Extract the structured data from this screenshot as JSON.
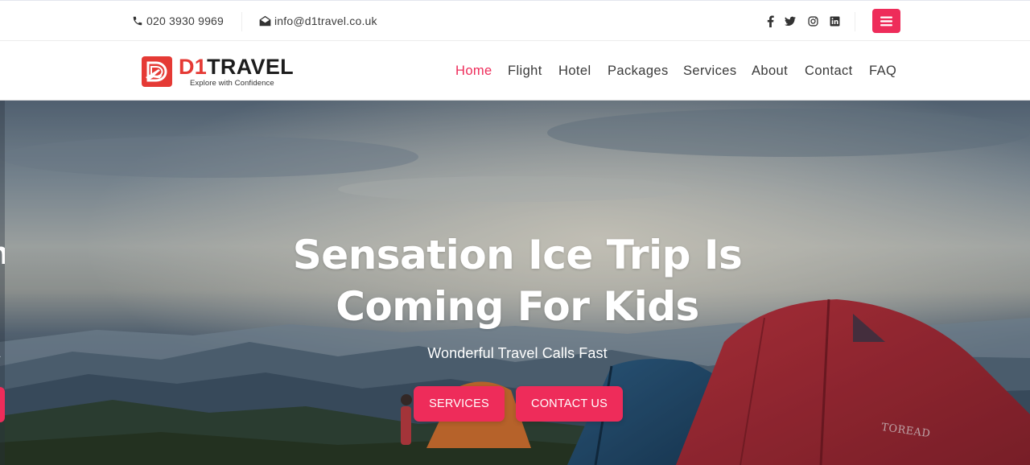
{
  "topbar": {
    "phone": "020 3930 9969",
    "email": "info@d1travel.co.uk",
    "phone_icon": "phone-icon",
    "email_icon": "envelope-icon",
    "social": [
      "facebook-icon",
      "twitter-icon",
      "instagram-icon",
      "linkedin-icon"
    ],
    "menu_icon": "hamburger-menu-icon"
  },
  "brand": {
    "name_prefix": "D1",
    "name_suffix": "TRAVEL",
    "tagline": "Explore with Confidence",
    "logo_icon": "d1-plane-logo-icon"
  },
  "nav": {
    "items": [
      {
        "label": "Home",
        "active": true
      },
      {
        "label": "Flight",
        "active": false
      },
      {
        "label": "Hotel",
        "active": false
      },
      {
        "label": "Packages",
        "active": false
      },
      {
        "label": "Services",
        "active": false
      },
      {
        "label": "About",
        "active": false
      },
      {
        "label": "Contact",
        "active": false
      },
      {
        "label": "FAQ",
        "active": false
      }
    ]
  },
  "hero": {
    "title_line1": "Sensation Ice Trip Is",
    "title_line2": "Coming For Kids",
    "subtitle": "Wonderful Travel Calls Fast",
    "buttons": {
      "services": "SERVICES",
      "contact": "CONTACT US"
    },
    "tent_brand": "TOREAD",
    "prev_slide_fragments": [
      "n",
      "a"
    ]
  },
  "colors": {
    "accent": "#ee2c5a",
    "logo_red": "#e53a35",
    "text_dark": "#3a3a3a"
  }
}
